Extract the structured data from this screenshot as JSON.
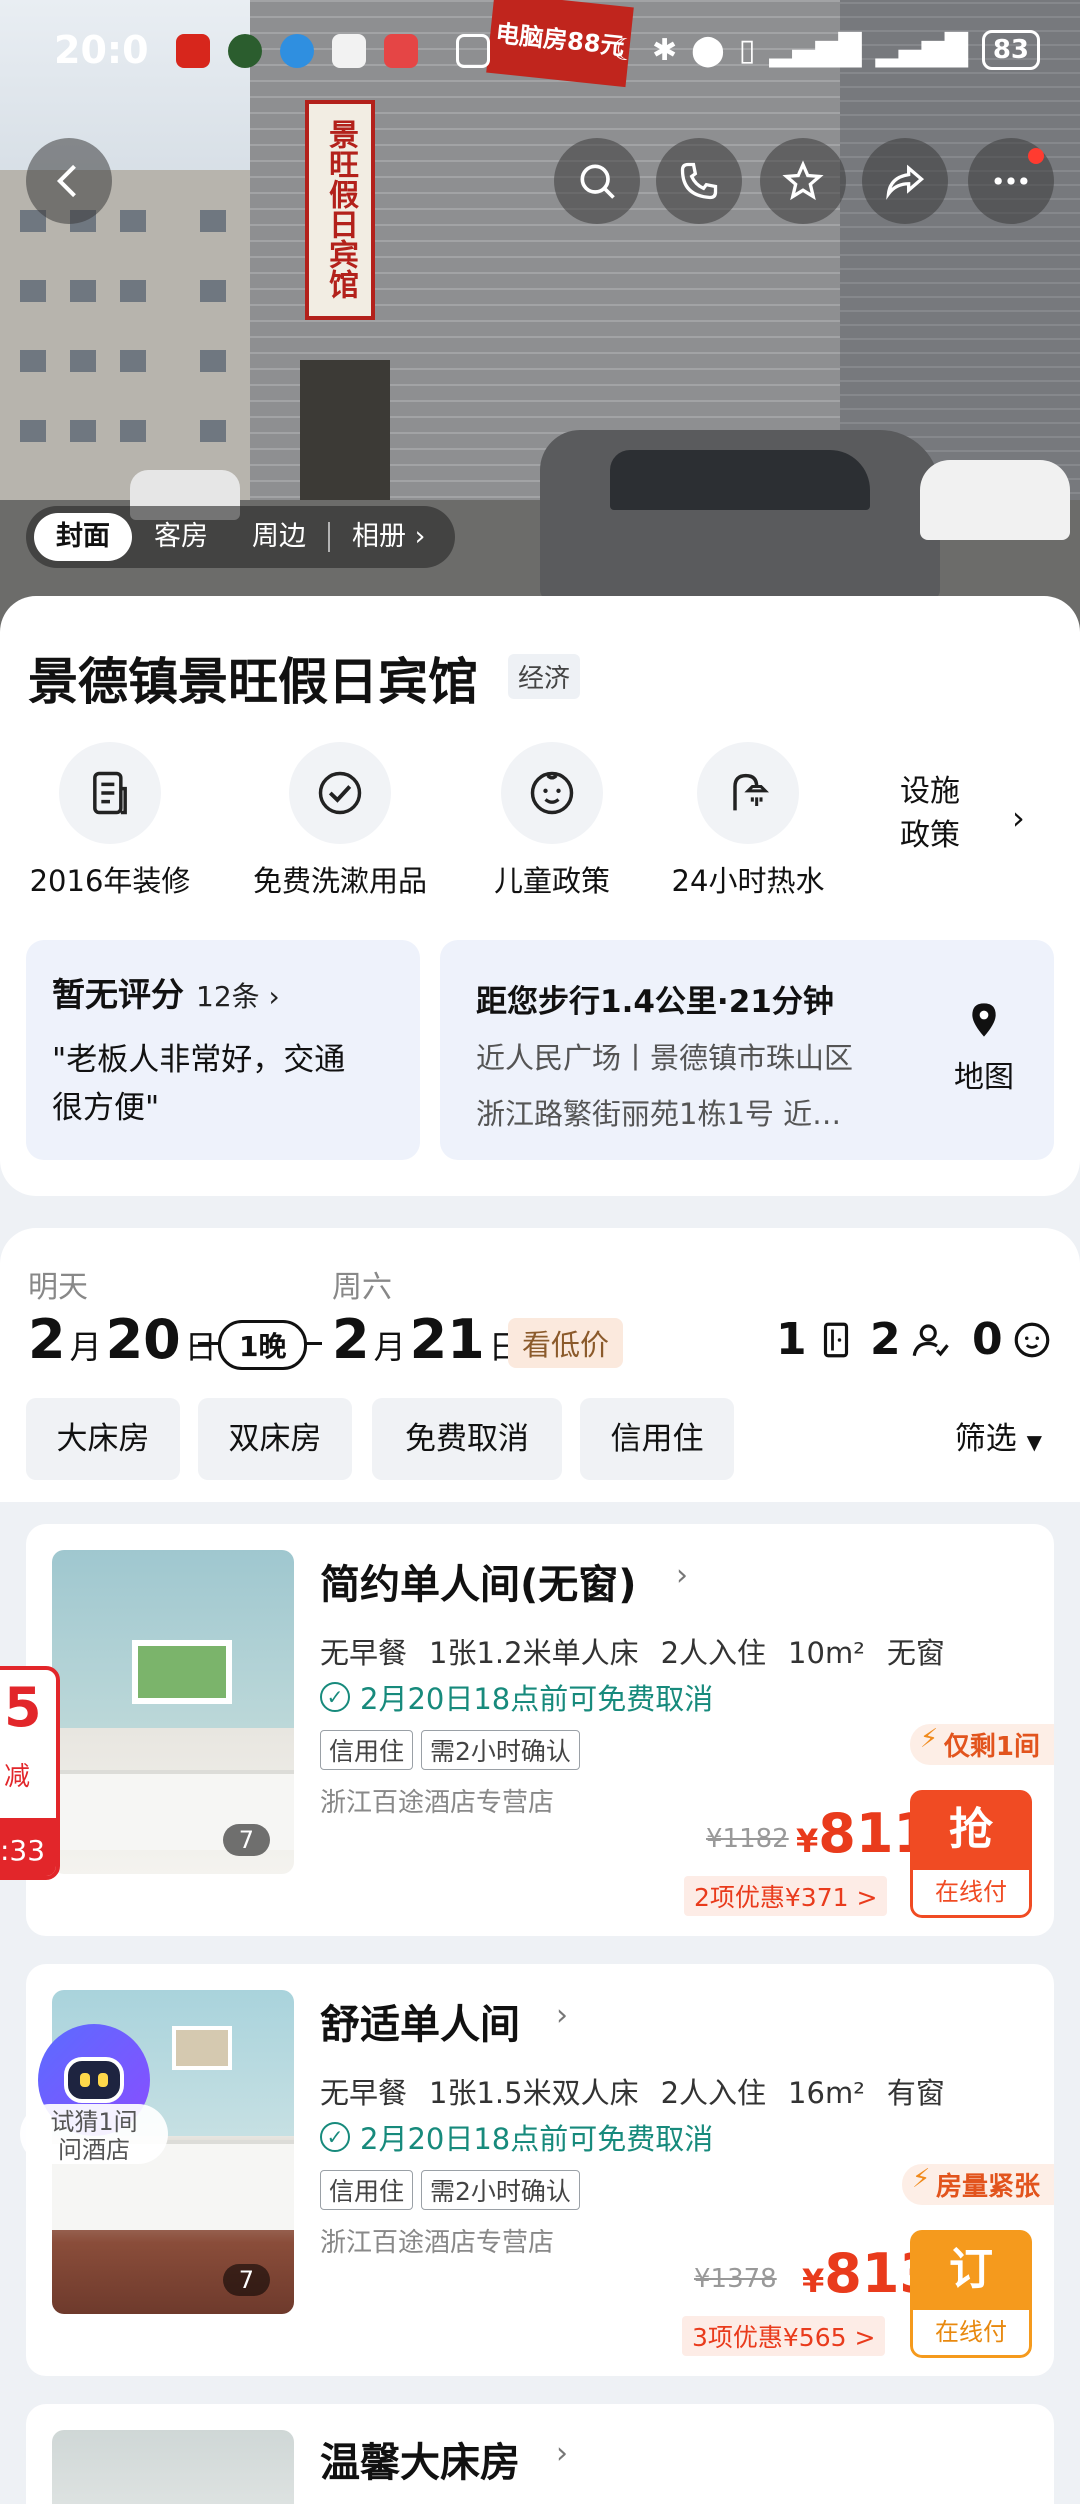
{
  "status_bar": {
    "time": "20:0",
    "battery": "83"
  },
  "photo_tabs": {
    "items": [
      "封面",
      "客房",
      "周边"
    ],
    "album": "相册"
  },
  "hero_signs": {
    "vertical": "景旺假日宾馆",
    "red_sign": "电脑房88元"
  },
  "hotel": {
    "name": "景德镇景旺假日宾馆",
    "tag": "经济"
  },
  "features": [
    {
      "label": "2016年装修",
      "icon": "renovation-icon"
    },
    {
      "label": "免费洗漱用品",
      "icon": "check-circle-icon"
    },
    {
      "label": "儿童政策",
      "icon": "child-face-icon"
    },
    {
      "label": "24小时热水",
      "icon": "shower-icon"
    }
  ],
  "features_more": {
    "line1": "设施",
    "line2": "政策"
  },
  "review": {
    "title": "暂无评分",
    "count": "12条",
    "quote_line1": "\"老板人非常好，交通",
    "quote_line2": "很方便\""
  },
  "location": {
    "distance": "距您步行1.4公里·21分钟",
    "line1": "近人民广场丨景德镇市珠山区",
    "line2": "浙江路繁街丽苑1栋1号 近…",
    "map_label": "地图"
  },
  "dates": {
    "checkin_label": "明天",
    "checkin_month": "2",
    "checkin_day": "20",
    "checkout_label": "周六",
    "checkout_month": "2",
    "checkout_day": "21",
    "month_unit": "月",
    "day_unit": "日",
    "nights": "1晚",
    "low_price": "看低价",
    "rooms": "1",
    "adults": "2",
    "children": "0"
  },
  "filters": [
    "大床房",
    "双床房",
    "免费取消",
    "信用住"
  ],
  "filter_more": "筛选",
  "rooms": [
    {
      "title": "简约单人间(无窗)",
      "specs": [
        "无早餐",
        "1张1.2米单人床",
        "2人入住",
        "10m²",
        "无窗"
      ],
      "cancel": "2月20日18点前可免费取消",
      "tags": [
        "信用住",
        "需2小时确认"
      ],
      "shop": "浙江百途酒店专营店",
      "alert": "仅剩1间",
      "photo_count": "7",
      "orig_price": "¥1182",
      "currency": "¥",
      "price": "811",
      "discount": "2项优惠¥371 >",
      "book_label": "抢",
      "pay_label": "在线付",
      "accent": "#f04b23"
    },
    {
      "title": "舒适单人间",
      "specs": [
        "无早餐",
        "1张1.5米双人床",
        "2人入住",
        "16m²",
        "有窗"
      ],
      "cancel": "2月20日18点前可免费取消",
      "tags": [
        "信用住",
        "需2小时确认"
      ],
      "shop": "浙江百途酒店专营店",
      "alert": "房量紧张",
      "photo_count": "7",
      "orig_price": "¥1378",
      "currency": "¥",
      "price": "813",
      "discount": "3项优惠¥565 >",
      "book_label": "订",
      "pay_label": "在线付",
      "accent": "#f59a1d"
    },
    {
      "title": "温馨大床房"
    }
  ],
  "promo": {
    "number": "5",
    "label": "减",
    "time": ":33"
  },
  "robot_bubble": {
    "line1": "试猜1间",
    "line2": "问酒店"
  }
}
